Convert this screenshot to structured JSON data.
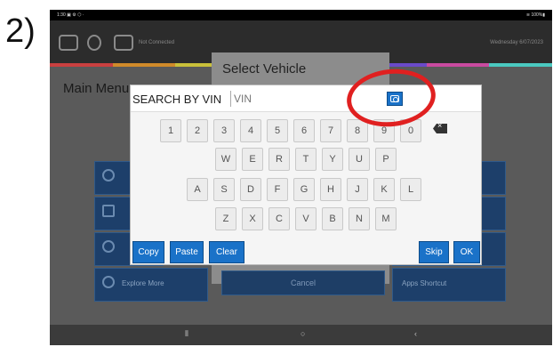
{
  "step_label": "2)",
  "statusbar": {
    "left": "1:30 ▣ ⚙ ⬡ ·",
    "right": "≋ 100%▮"
  },
  "appbar": {
    "connection_status": "Not Connected",
    "date": "Wednesday 6/07/2023",
    "stripe_colors": [
      "#c94040",
      "#d08a2a",
      "#c9c03a",
      "#4aa04a",
      "#3a8ac9",
      "#6a4ac9",
      "#c94aa0",
      "#4ac9c0"
    ]
  },
  "main": {
    "title": "Main Menu",
    "tiles": [
      {
        "label": ""
      },
      {
        "label": ""
      },
      {
        "label": ""
      },
      {
        "label": "Explore More"
      },
      {
        "label": ""
      },
      {
        "label": ""
      },
      {
        "label": ""
      },
      {
        "label": "Apps Shortcut"
      }
    ]
  },
  "select_vehicle": {
    "title": "Select Vehicle",
    "cancel_label": "Cancel"
  },
  "vin_search": {
    "label": "SEARCH BY VIN",
    "placeholder": "VIN",
    "camera_icon": "camera-icon"
  },
  "keyboard": {
    "row1": [
      "1",
      "2",
      "3",
      "4",
      "5",
      "6",
      "7",
      "8",
      "9",
      "0"
    ],
    "row2": [
      "W",
      "E",
      "R",
      "T",
      "Y",
      "U",
      "P"
    ],
    "row3": [
      "A",
      "S",
      "D",
      "F",
      "G",
      "H",
      "J",
      "K",
      "L"
    ],
    "row4": [
      "Z",
      "X",
      "C",
      "V",
      "B",
      "N",
      "M"
    ],
    "backspace_icon": "backspace-icon"
  },
  "actions": {
    "copy": "Copy",
    "paste": "Paste",
    "clear": "Clear",
    "skip": "Skip",
    "ok": "OK"
  },
  "navbar": {
    "recent": "⦀",
    "home": "○",
    "back": "‹"
  },
  "annotation": {
    "ring_color": "#e02020"
  }
}
